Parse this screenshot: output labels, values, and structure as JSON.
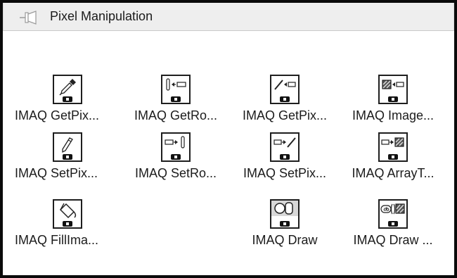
{
  "palette": {
    "title": "Pixel Manipulation",
    "pin_icon": "pin-icon"
  },
  "items": [
    {
      "label": "IMAQ GetPix...",
      "icon": "eyedropper-icon"
    },
    {
      "label": "IMAQ GetRo...",
      "icon": "get-row-icon"
    },
    {
      "label": "IMAQ GetPix...",
      "icon": "get-pixel-line-icon"
    },
    {
      "label": "IMAQ Image...",
      "icon": "image-to-array-icon"
    },
    {
      "label": "IMAQ SetPix...",
      "icon": "pencil-icon"
    },
    {
      "label": "IMAQ SetRo...",
      "icon": "set-row-icon"
    },
    {
      "label": "IMAQ SetPix...",
      "icon": "set-pixel-line-icon"
    },
    {
      "label": "IMAQ ArrayT...",
      "icon": "array-to-image-icon"
    },
    {
      "label": "IMAQ FillIma...",
      "icon": "paint-bucket-icon"
    },
    {
      "label": "IMAQ Draw",
      "icon": "draw-shapes-icon"
    },
    {
      "label": "IMAQ Draw ...",
      "icon": "draw-text-icon"
    }
  ],
  "colors": {
    "titlebar_bg": "#eeeeee",
    "border": "#0a0a0a",
    "icon_badge": "#111111"
  }
}
